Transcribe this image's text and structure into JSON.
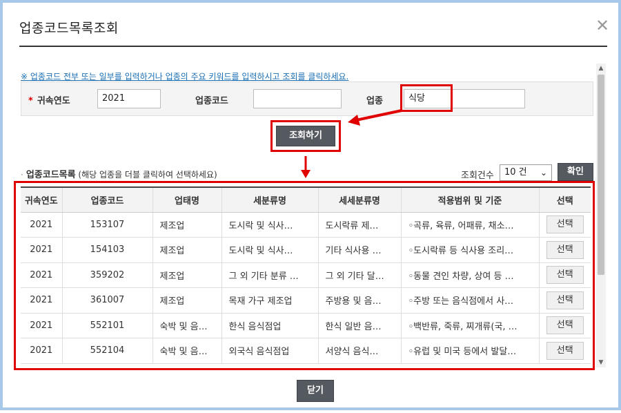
{
  "dialog": {
    "title": "업종코드목록조회",
    "close_icon": "✕"
  },
  "notice": "※ 업종코드 전부 또는 일부를 입력하거나 업종의 주요 키워드를 입력하시고 조회를 클릭하세요.",
  "search": {
    "year_label": "귀속연도",
    "year_value": "2021",
    "code_label": "업종코드",
    "code_value": "",
    "industry_label": "업종",
    "industry_value": "식당",
    "search_button": "조회하기"
  },
  "list": {
    "title": "업종코드목록",
    "hint": "(해당 업종을 더블 클릭하여 선택하세요)",
    "count_label": "조회건수",
    "count_value": "10 건",
    "confirm_button": "확인",
    "columns": [
      "귀속연도",
      "업종코드",
      "업태명",
      "세분류명",
      "세세분류명",
      "적용범위 및 기준",
      "선택"
    ],
    "rows": [
      {
        "year": "2021",
        "code": "153107",
        "biz": "제조업",
        "sub": "도시락 및 식사…",
        "subsub": "도시락류 제…",
        "scope": "◦곡류, 육류, 어패류, 채소…",
        "select": "선택"
      },
      {
        "year": "2021",
        "code": "154103",
        "biz": "제조업",
        "sub": "도시락 및 식사…",
        "subsub": "기타 식사용 …",
        "scope": "◦도시락류 등 식사용 조리…",
        "select": "선택"
      },
      {
        "year": "2021",
        "code": "359202",
        "biz": "제조업",
        "sub": "그 외 기타 분류 …",
        "subsub": "그 외 기타 달…",
        "scope": "◦동물 견인 차량, 상여 등 …",
        "select": "선택"
      },
      {
        "year": "2021",
        "code": "361007",
        "biz": "제조업",
        "sub": "목재 가구 제조업",
        "subsub": "주방용 및 음…",
        "scope": "◦주방 또는 음식점에서 사…",
        "select": "선택"
      },
      {
        "year": "2021",
        "code": "552101",
        "biz": "숙박 및 음…",
        "sub": "한식 음식점업",
        "subsub": "한식 일반 음…",
        "scope": "◦백반류, 죽류, 찌개류(국, …",
        "select": "선택"
      },
      {
        "year": "2021",
        "code": "552104",
        "biz": "숙박 및 음…",
        "sub": "외국식 음식점업",
        "subsub": "서양식 음식…",
        "scope": "◦유럽 및 미국 등에서 발달…",
        "select": "선택"
      }
    ]
  },
  "footer": {
    "close_button": "닫기"
  },
  "colors": {
    "highlight": "#e00000",
    "button_dark": "#555a60",
    "frame": "#a7c8e8",
    "notice": "#1a6fb4"
  }
}
